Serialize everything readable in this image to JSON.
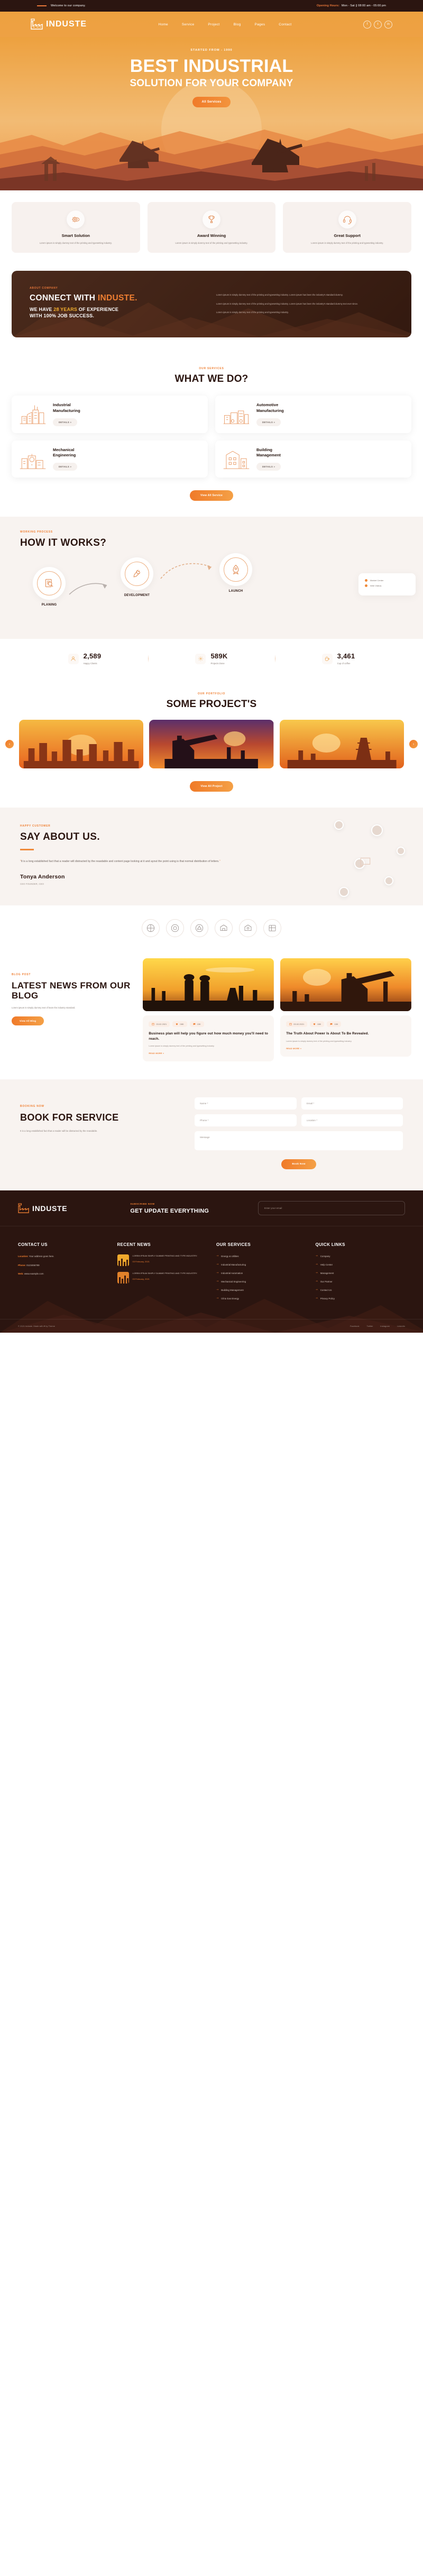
{
  "topbar": {
    "welcome": "Welcome to our company.",
    "hours_label": "Opening Hours:",
    "hours_value": "Mon - Sat || 08:00 am - 05:00 pm"
  },
  "brand": {
    "name": "INDUSTE",
    "icon": "factory-icon"
  },
  "nav": {
    "items": [
      {
        "label": "Home"
      },
      {
        "label": "Service"
      },
      {
        "label": "Project"
      },
      {
        "label": "Blog"
      },
      {
        "label": "Pages"
      },
      {
        "label": "Contact"
      }
    ],
    "socials": [
      {
        "name": "facebook-icon",
        "glyph": "f"
      },
      {
        "name": "twitter-icon",
        "glyph": "t"
      },
      {
        "name": "linkedin-icon",
        "glyph": "in"
      }
    ]
  },
  "hero": {
    "kicker": "STARTED FROM - 1990",
    "title": "BEST INDUSTRIAL",
    "subtitle": "SOLUTION FOR YOUR COMPANY",
    "cta": "All Services"
  },
  "features": [
    {
      "icon": "gear-brain-icon",
      "title": "Smart Solution",
      "desc": "Lorem ipsum is simply dummy text of the printing and typesetting industry."
    },
    {
      "icon": "trophy-icon",
      "title": "Award Winning",
      "desc": "Lorem ipsum is simply dummy text of the printing and typesetting industry."
    },
    {
      "icon": "support-icon",
      "title": "Great Support",
      "desc": "Lorem ipsum is simply dummy text of the printing and typesetting industry."
    }
  ],
  "about": {
    "kicker": "ABOUT COMPANY",
    "title_a": "CONNECT WITH ",
    "title_b": "INDUSTE.",
    "sub_a": "WE HAVE ",
    "sub_years": "28 YEARS",
    "sub_b": " OF EXPERIENCE",
    "sub_c": "WITH 100% JOB SUCCESS.",
    "p1": "Lorem ipsum is simply dummy text of the printing and typesetting industry. Lorem ipsum has been the industry's standard dummy.",
    "p2": "Lorem ipsum is simply dummy text of the printing and typesetting industry. Lorem ipsum has been the industry's standard dummy text ever since.",
    "p3": "Lorem ipsum is simply dummy text of the printing and typesetting industry."
  },
  "services": {
    "kicker": "OUR SERVICES",
    "title": "WHAT WE DO?",
    "details_label": "DETAILS »",
    "items": [
      {
        "icon": "factory-line-icon",
        "name": "Industrial\nManufacturing"
      },
      {
        "icon": "car-factory-icon",
        "name": "Automotive\nManufacturing"
      },
      {
        "icon": "mechanical-icon",
        "name": "Mechanical\nEngineering"
      },
      {
        "icon": "building-icon",
        "name": "Building\nManagement"
      }
    ],
    "cta": "View All Service"
  },
  "process": {
    "kicker": "WORKING PROCESS",
    "title": "HOW IT WORKS?",
    "steps": [
      {
        "icon": "planning-icon",
        "label": "PLANING"
      },
      {
        "icon": "development-icon",
        "label": "DEVELOPMENT"
      },
      {
        "icon": "launch-icon",
        "label": "LAUNCH"
      }
    ],
    "box": [
      {
        "text": "Market Center"
      },
      {
        "text": "Web Videos"
      }
    ]
  },
  "stats": [
    {
      "icon": "user-icon",
      "number": "2,589",
      "label": "Happy Clients"
    },
    {
      "icon": "gear-icon",
      "number": "589K",
      "label": "Projects Done"
    },
    {
      "icon": "coffee-icon",
      "number": "3,461",
      "label": "Cup of coffee"
    }
  ],
  "portfolio": {
    "kicker": "OUR PORTFOLIO",
    "title": "SOME PROJECT'S",
    "cta": "View All Project",
    "prev": "‹",
    "next": "›",
    "slides": [
      {
        "name": "refinery-sunset"
      },
      {
        "name": "oil-pump-night"
      },
      {
        "name": "oil-rig-sunrise"
      }
    ]
  },
  "testimonial": {
    "kicker": "HAPPY CUSTOMER",
    "title": "SAY ABOUT US.",
    "quote": "It is a long established fact that a reader will distracted by the reasdable and content page looking at it and ayout the point using is that normal distribution of letters.",
    "name": "Tonya Anderson",
    "role": "CEO FOUNDER, CEO"
  },
  "clients": [
    {
      "name": "client-logo-1"
    },
    {
      "name": "client-logo-2"
    },
    {
      "name": "client-logo-3"
    },
    {
      "name": "client-logo-4"
    },
    {
      "name": "client-logo-5"
    },
    {
      "name": "client-logo-6"
    }
  ],
  "blog": {
    "kicker": "BLOG POST",
    "title": "LATEST NEWS FROM OUR BLOG",
    "desc": "Lorem ipsum is simply dummy text of leam the industry standard.",
    "cta": "View All Blog",
    "posts": [
      {
        "date": "03.02.2021",
        "likes": "08K",
        "comments": "15K",
        "title": "Business plan will help you figure out how much money you'll need to reach.",
        "text": "Lorem ipsum is simply dummy text of the printing and typesetting industry.",
        "more": "READ MORE »"
      },
      {
        "date": "03.02.2021",
        "likes": "08K",
        "comments": "15K",
        "title": "The Truth About Power Is About To Be Revealed.",
        "text": "Lorem ipsum is simply dummy text of the printing and typesetting industry.",
        "more": "READ MORE »"
      }
    ]
  },
  "booking": {
    "kicker": "BOOKING NOW",
    "title": "BOOK FOR SERVICE",
    "desc": "It is a long established fact that a reader will be distracted by the reasdable.",
    "fields": {
      "name": "Name *",
      "email": "Email *",
      "phone": "Phone *",
      "location": "Location *",
      "message": "Message"
    },
    "submit": "Book Now"
  },
  "footer": {
    "newsletter": {
      "kicker": "SUBSCRIBE NOW",
      "title": "GET UPDATE EVERYTHING",
      "placeholder": "Enter your email"
    },
    "contact": {
      "heading": "CONTACT US",
      "rows": [
        {
          "label": "Location:",
          "value": "Your address goes here."
        },
        {
          "label": "Phone:",
          "value": "0123456789"
        },
        {
          "label": "Web:",
          "value": "www.example.com"
        }
      ]
    },
    "news": {
      "heading": "RECENT NEWS",
      "items": [
        {
          "title": "LOREM IPSUM SIMPLY DUMME PRINTING AND TYPE INDUSTRY.",
          "date": "03 February, 2021"
        },
        {
          "title": "LOREM IPSUM SIMPLY DUMME PRINTING AND TYPE INDUSTRY.",
          "date": "03 February, 2021"
        }
      ]
    },
    "our_services": {
      "heading": "OUR SERVICES",
      "items": [
        {
          "label": "Energy & Utilities"
        },
        {
          "label": "Industrial Manufacturing"
        },
        {
          "label": "Industrial Automation"
        },
        {
          "label": "Mechanical Engineering"
        },
        {
          "label": "Building Management"
        },
        {
          "label": "Oil & Gas Energy"
        }
      ]
    },
    "quick_links": {
      "heading": "QUICK LINKS",
      "items": [
        {
          "label": "Company"
        },
        {
          "label": "Help Center"
        },
        {
          "label": "Management"
        },
        {
          "label": "Our Partner"
        },
        {
          "label": "Contact Us"
        },
        {
          "label": "Privacy Policy"
        }
      ]
    },
    "bottom": {
      "copyright": "© 2021 Induste. Made with ♥ by Theme",
      "links": [
        {
          "label": "Facebook"
        },
        {
          "label": "Twitter"
        },
        {
          "label": "Instagram"
        },
        {
          "label": "Linkedin"
        }
      ]
    }
  },
  "colors": {
    "accent": "#ef7f32",
    "dark": "#2b1510",
    "hero": "#eda13f",
    "cream": "#f8f3f0"
  }
}
